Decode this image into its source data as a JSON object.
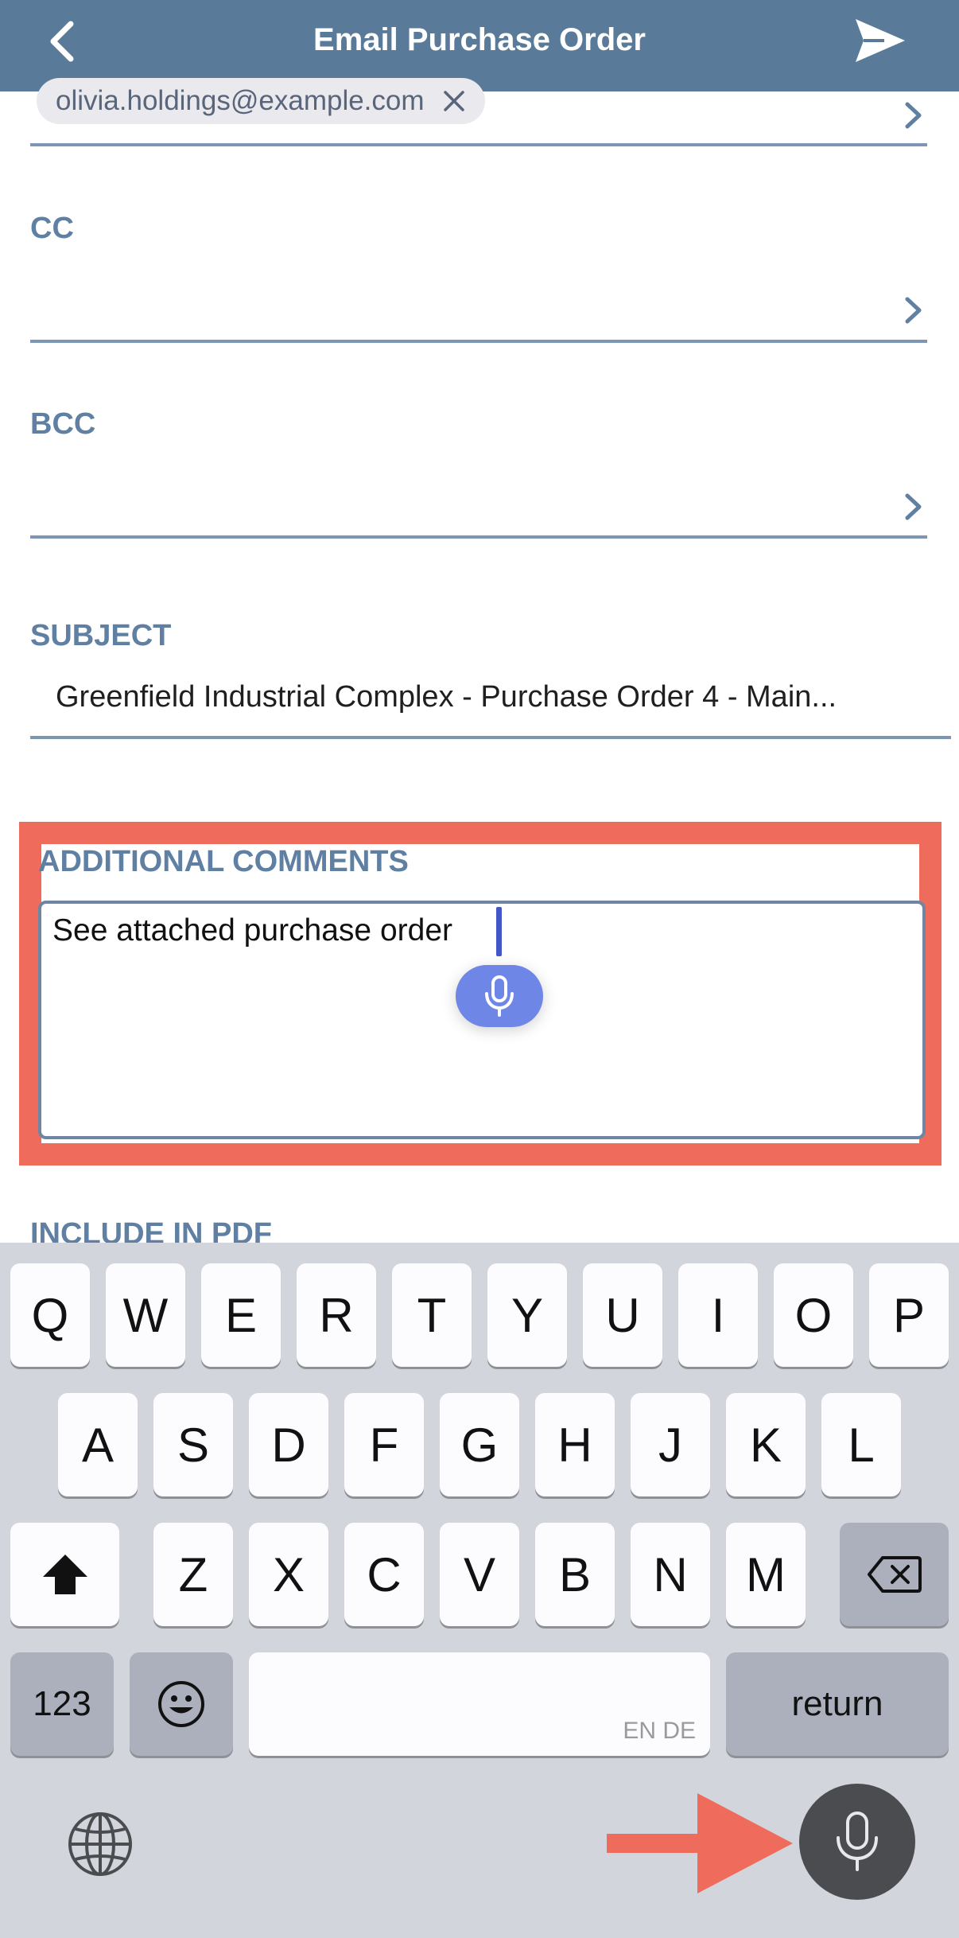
{
  "header": {
    "title": "Email Purchase Order"
  },
  "to": {
    "chip": "olivia.holdings@example.com"
  },
  "cc": {
    "label": "CC"
  },
  "bcc": {
    "label": "BCC"
  },
  "subject": {
    "label": "SUBJECT",
    "value": "Greenfield Industrial Complex - Purchase Order 4 - Main..."
  },
  "comments": {
    "label": "ADDITIONAL COMMENTS",
    "value": "See attached purchase order"
  },
  "include_pdf": {
    "label": "INCLUDE IN PDF"
  },
  "keyboard": {
    "row1": [
      "Q",
      "W",
      "E",
      "R",
      "T",
      "Y",
      "U",
      "I",
      "O",
      "P"
    ],
    "row2": [
      "A",
      "S",
      "D",
      "F",
      "G",
      "H",
      "J",
      "K",
      "L"
    ],
    "row3": [
      "Z",
      "X",
      "C",
      "V",
      "B",
      "N",
      "M"
    ],
    "numbers_key": "123",
    "space_languages": "EN DE",
    "return_key": "return"
  },
  "colors": {
    "header": "#5a7a9a",
    "label": "#5f7fa3",
    "highlight": "#ef6b5b",
    "dictation": "#6e86e6"
  }
}
